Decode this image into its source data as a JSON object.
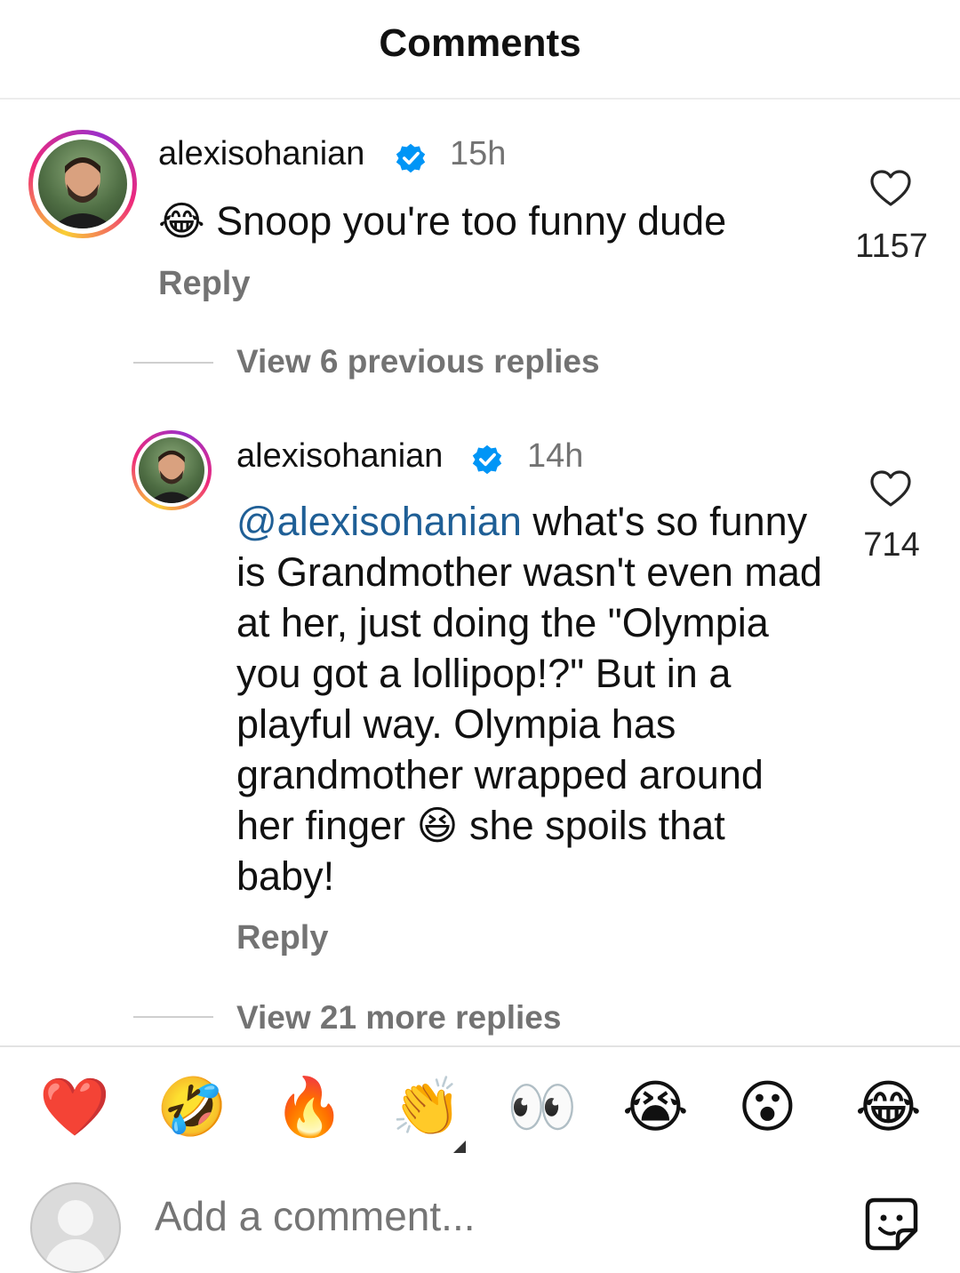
{
  "header": {
    "title": "Comments"
  },
  "comments": [
    {
      "username": "alexisohanian",
      "verified": true,
      "time": "15h",
      "emoji_prefix": "😂",
      "text": " Snoop you're too funny dude",
      "likes": "1157",
      "reply_label": "Reply",
      "view_replies": "View 6 previous replies"
    },
    {
      "username": "alexisohanian",
      "verified": true,
      "time": "14h",
      "mention": "@alexisohanian",
      "text_part1": " what's so funny is Grandmother wasn't even mad at her, just doing the \"Olympia you got a lollipop!?\" But in a playful way. Olympia has grandmother wrapped around her finger ",
      "inline_emoji": "😆",
      "text_part2": " she spoils that baby!",
      "likes": "714",
      "reply_label": "Reply",
      "view_replies": "View 21 more replies"
    }
  ],
  "quick_reactions": [
    "❤️",
    "🤣",
    "🔥",
    "👏",
    "👀",
    "😭",
    "😮",
    "😂"
  ],
  "composer": {
    "placeholder": "Add a comment..."
  },
  "colors": {
    "mention": "#1f5f96",
    "verified": "#0095f6",
    "secondary_text": "#737373"
  }
}
